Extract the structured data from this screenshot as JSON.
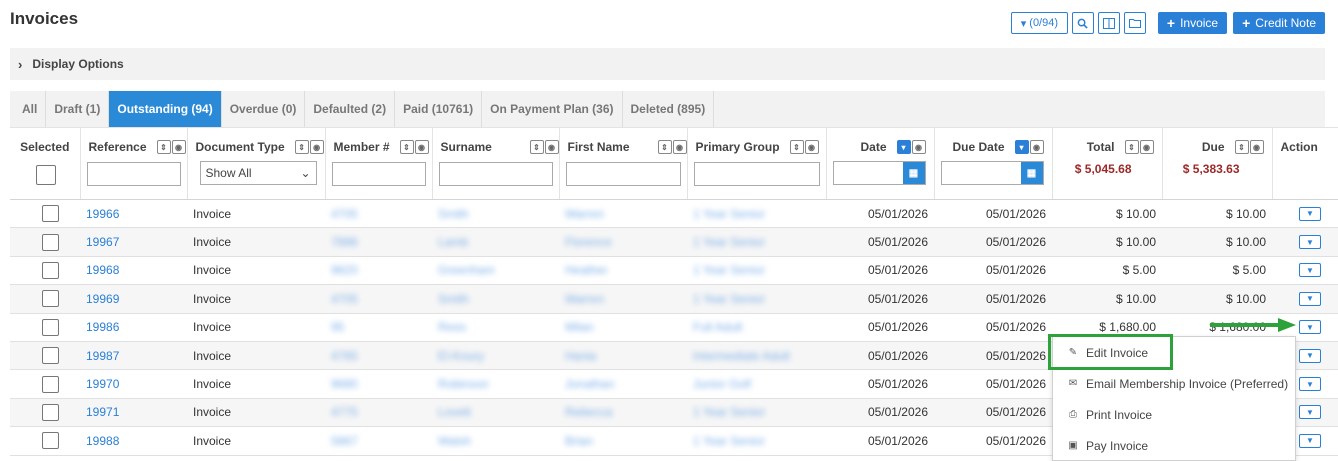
{
  "page": {
    "title": "Invoices"
  },
  "toolbar": {
    "filter_count": "(0/94)",
    "invoice_label": "Invoice",
    "credit_note_label": "Credit Note"
  },
  "display_options": {
    "label": "Display Options"
  },
  "tabs": [
    {
      "label": "All",
      "active": false
    },
    {
      "label": "Draft (1)",
      "active": false
    },
    {
      "label": "Outstanding (94)",
      "active": true
    },
    {
      "label": "Overdue (0)",
      "active": false
    },
    {
      "label": "Defaulted (2)",
      "active": false
    },
    {
      "label": "Paid (10761)",
      "active": false
    },
    {
      "label": "On Payment Plan (36)",
      "active": false
    },
    {
      "label": "Deleted (895)",
      "active": false
    }
  ],
  "columns": {
    "selected": "Selected",
    "reference": "Reference",
    "document_type": "Document Type",
    "member": "Member #",
    "surname": "Surname",
    "first_name": "First Name",
    "primary_group": "Primary Group",
    "date": "Date",
    "due_date": "Due Date",
    "total": "Total",
    "due": "Due",
    "action": "Action"
  },
  "filters": {
    "document_type_value": "Show All",
    "total_sum": "$ 5,045.68",
    "due_sum": "$ 5,383.63"
  },
  "rows": [
    {
      "ref": "19966",
      "type": "Invoice",
      "member": "4705",
      "surname": "Smith",
      "first": "Warren",
      "group": "1 Year Senior",
      "date": "05/01/2026",
      "due_date": "05/01/2026",
      "total": "$ 10.00",
      "due": "$ 10.00"
    },
    {
      "ref": "19967",
      "type": "Invoice",
      "member": "7886",
      "surname": "Lamb",
      "first": "Florence",
      "group": "1 Year Senior",
      "date": "05/01/2026",
      "due_date": "05/01/2026",
      "total": "$ 10.00",
      "due": "$ 10.00"
    },
    {
      "ref": "19968",
      "type": "Invoice",
      "member": "9820",
      "surname": "Greenham",
      "first": "Heather",
      "group": "1 Year Senior",
      "date": "05/01/2026",
      "due_date": "05/01/2026",
      "total": "$ 5.00",
      "due": "$ 5.00"
    },
    {
      "ref": "19969",
      "type": "Invoice",
      "member": "4705",
      "surname": "Smith",
      "first": "Warren",
      "group": "1 Year Senior",
      "date": "05/01/2026",
      "due_date": "05/01/2026",
      "total": "$ 10.00",
      "due": "$ 10.00"
    },
    {
      "ref": "19986",
      "type": "Invoice",
      "member": "95",
      "surname": "Rees",
      "first": "Milan",
      "group": "Full Adult",
      "date": "05/01/2026",
      "due_date": "05/01/2026",
      "total": "$ 1,680.00",
      "due": "$ 1,680.00"
    },
    {
      "ref": "19987",
      "type": "Invoice",
      "member": "4765",
      "surname": "El-Koury",
      "first": "Hania",
      "group": "Intermediate Adult",
      "date": "05/01/2026",
      "due_date": "05/01/2026",
      "total": "",
      "due": ""
    },
    {
      "ref": "19970",
      "type": "Invoice",
      "member": "9680",
      "surname": "Robinson",
      "first": "Jonathan",
      "group": "Junior Golf",
      "date": "05/01/2026",
      "due_date": "05/01/2026",
      "total": "",
      "due": ""
    },
    {
      "ref": "19971",
      "type": "Invoice",
      "member": "4775",
      "surname": "Lovett",
      "first": "Rebecca",
      "group": "1 Year Senior",
      "date": "05/01/2026",
      "due_date": "05/01/2026",
      "total": "",
      "due": ""
    },
    {
      "ref": "19988",
      "type": "Invoice",
      "member": "5867",
      "surname": "Walsh",
      "first": "Brian",
      "group": "1 Year Senior",
      "date": "05/01/2026",
      "due_date": "05/01/2026",
      "total": "",
      "due": ""
    }
  ],
  "action_menu": {
    "items": [
      {
        "label": "Edit Invoice",
        "icon": "pencil-icon"
      },
      {
        "label": "Email Membership Invoice (Preferred)",
        "icon": "envelope-icon"
      },
      {
        "label": "Print Invoice",
        "icon": "printer-icon"
      },
      {
        "label": "Pay Invoice",
        "icon": "money-icon"
      }
    ]
  },
  "colors": {
    "accent": "#2a8ad8",
    "sum_red": "#9b2a2a",
    "highlight_green": "#2ea23a"
  }
}
